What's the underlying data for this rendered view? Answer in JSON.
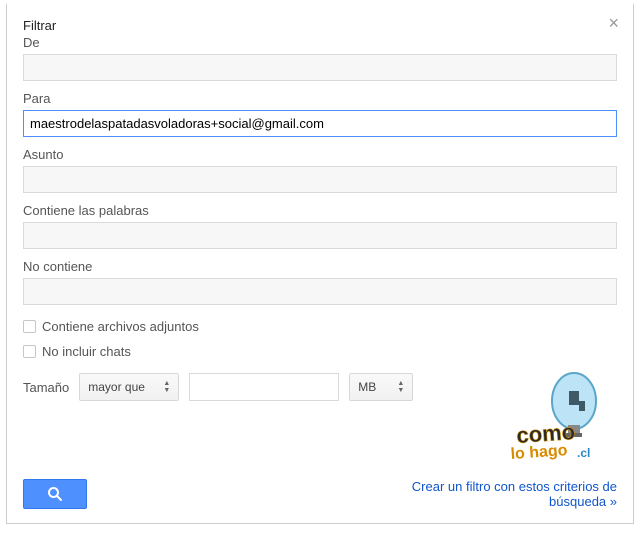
{
  "dialog": {
    "title": "Filtrar",
    "close_glyph": "×",
    "fields": {
      "from": {
        "label": "De",
        "value": ""
      },
      "to": {
        "label": "Para",
        "value": "maestrodelaspatadasvoladoras+social@gmail.com"
      },
      "subject": {
        "label": "Asunto",
        "value": ""
      },
      "has_words": {
        "label": "Contiene las palabras",
        "value": ""
      },
      "doesnt_have": {
        "label": "No contiene",
        "value": ""
      }
    },
    "checkboxes": {
      "has_attachment": {
        "label": "Contiene archivos adjuntos",
        "checked": false
      },
      "exclude_chats": {
        "label": "No incluir chats",
        "checked": false
      }
    },
    "size": {
      "label": "Tamaño",
      "operator": "mayor que",
      "value": "",
      "unit": "MB"
    },
    "actions": {
      "create_filter_link": "Crear un filtro con estos criterios de búsqueda »"
    }
  },
  "watermark": {
    "text_top": "como",
    "text_mid": "lo hago",
    "tld": ".cl"
  },
  "colors": {
    "primary_button": "#4d90fe",
    "link": "#1155cc",
    "focus_border": "#4d90fe"
  }
}
